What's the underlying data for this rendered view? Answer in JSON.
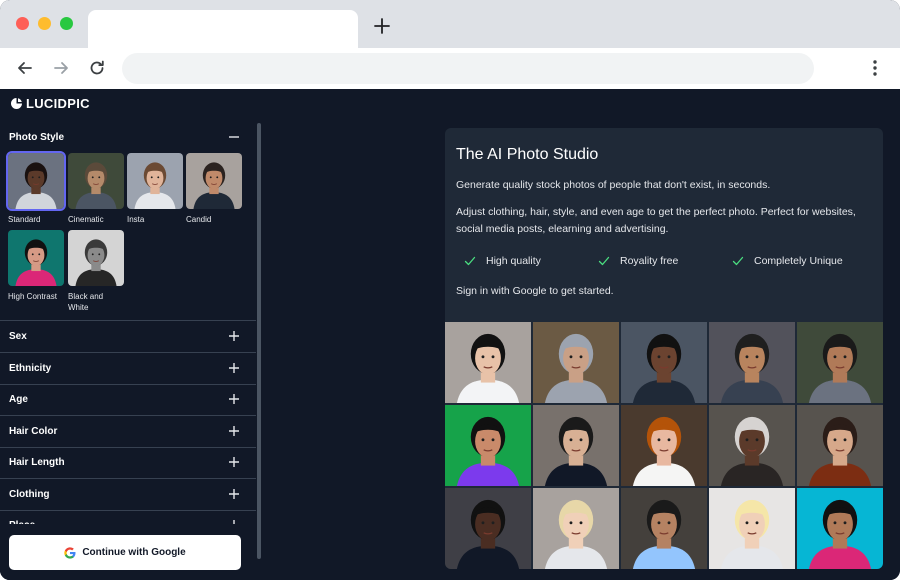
{
  "app": {
    "logo_text": "LUCIDPIC"
  },
  "sidebar": {
    "photo_style": {
      "title": "Photo Style",
      "styles": [
        {
          "label": "Standard",
          "bg": "#6b7280",
          "skin": "#5b3a2a",
          "hair": "#1a1110",
          "shirt": "#d1d5db"
        },
        {
          "label": "Cinematic",
          "bg": "#3f4a3a",
          "skin": "#b48a6a",
          "hair": "#5b4a3a",
          "shirt": "#4b5563"
        },
        {
          "label": "Insta",
          "bg": "#9ca3af",
          "skin": "#e0b49a",
          "hair": "#6b4a34",
          "shirt": "#e5e7eb"
        },
        {
          "label": "Candid",
          "bg": "#a8a29e",
          "skin": "#c08a6a",
          "hair": "#2b2320",
          "shirt": "#1f2937"
        },
        {
          "label": "High Contrast",
          "bg": "#0f766e",
          "skin": "#d69a85",
          "hair": "#111111",
          "shirt": "#db2777"
        },
        {
          "label": "Black and White",
          "bg": "#d4d4d4",
          "skin": "#8a8a8a",
          "hair": "#3a3a3a",
          "shirt": "#262626"
        }
      ]
    },
    "sections": [
      "Sex",
      "Ethnicity",
      "Age",
      "Hair Color",
      "Hair Length",
      "Clothing",
      "Place"
    ]
  },
  "footer": {
    "google_button_label": "Continue with Google"
  },
  "hero": {
    "title": "The AI Photo Studio",
    "subtitle": "Generate quality stock photos of people that don't exist, in seconds.",
    "description": "Adjust clothing, hair, style, and even age to get the perfect photo. Perfect for websites, social media posts, elearning and advertising.",
    "features": [
      "High quality",
      "Royality free",
      "Completely Unique"
    ],
    "cta": "Sign in with Google to get started."
  },
  "gallery": [
    {
      "bg": "#a8a29e",
      "skin": "#e8c2a8",
      "hair": "#111111",
      "shirt": "#f3f4f6"
    },
    {
      "bg": "#6b5a44",
      "skin": "#c9a086",
      "hair": "#9ca3af",
      "shirt": "#9ca3af"
    },
    {
      "bg": "#4b5563",
      "skin": "#6b4330",
      "hair": "#111111",
      "shirt": "#1f2937"
    },
    {
      "bg": "#52525b",
      "skin": "#b8845e",
      "hair": "#1f1f1f",
      "shirt": "#374151"
    },
    {
      "bg": "#3f4a3a",
      "skin": "#b07a58",
      "hair": "#1a1a1a",
      "shirt": "#6b7280"
    },
    {
      "bg": "#16a34a",
      "skin": "#c98a6a",
      "hair": "#111111",
      "shirt": "#7c3aed"
    },
    {
      "bg": "#78716c",
      "skin": "#d8b094",
      "hair": "#1a1a1a",
      "shirt": "#111827"
    },
    {
      "bg": "#4a3a2e",
      "skin": "#e8b8a0",
      "hair": "#b45309",
      "shirt": "#f5f5f4"
    },
    {
      "bg": "#57534e",
      "skin": "#5b3a2a",
      "hair": "#d6d3d1",
      "shirt": "#292524"
    },
    {
      "bg": "#57534e",
      "skin": "#d6a88a",
      "hair": "#2b1d18",
      "shirt": "#7c2d12"
    },
    {
      "bg": "#3f3f46",
      "skin": "#4a2d22",
      "hair": "#111111",
      "shirt": "#111827"
    },
    {
      "bg": "#a8a29e",
      "skin": "#f0d0b8",
      "hair": "#e7d7a8",
      "shirt": "#e5e7eb"
    },
    {
      "bg": "#44403c",
      "skin": "#b58262",
      "hair": "#1a1a1a",
      "shirt": "#93c5fd"
    },
    {
      "bg": "#e7e5e4",
      "skin": "#f0d0b8",
      "hair": "#f5e6a8",
      "shirt": "#e5e7eb"
    },
    {
      "bg": "#06b6d4",
      "skin": "#b07a58",
      "hair": "#111111",
      "shirt": "#db2777"
    }
  ]
}
